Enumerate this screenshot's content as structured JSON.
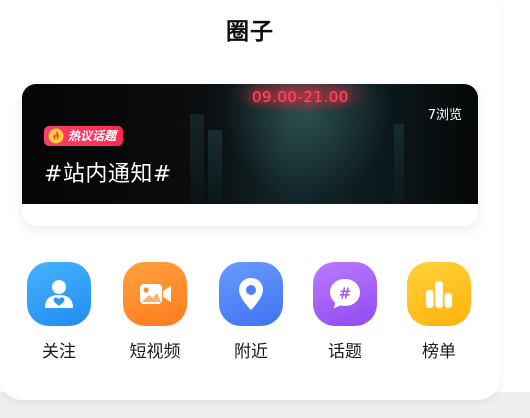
{
  "header": {
    "title": "圈子"
  },
  "banner": {
    "neon_text": "09.00-21.00",
    "views": "7浏览",
    "badge": "热议话题",
    "topic": "#站内通知#"
  },
  "shortcuts": [
    {
      "label": "关注",
      "icon": "follow-user-icon",
      "color": "#2f9bf5"
    },
    {
      "label": "短视频",
      "icon": "short-video-icon",
      "color": "#ff8a2b"
    },
    {
      "label": "附近",
      "icon": "location-pin-icon",
      "color": "#4e82f6"
    },
    {
      "label": "话题",
      "icon": "hashtag-chat-icon",
      "color": "#a35df2"
    },
    {
      "label": "榜单",
      "icon": "ranking-bars-icon",
      "color": "#ffc21a"
    }
  ]
}
